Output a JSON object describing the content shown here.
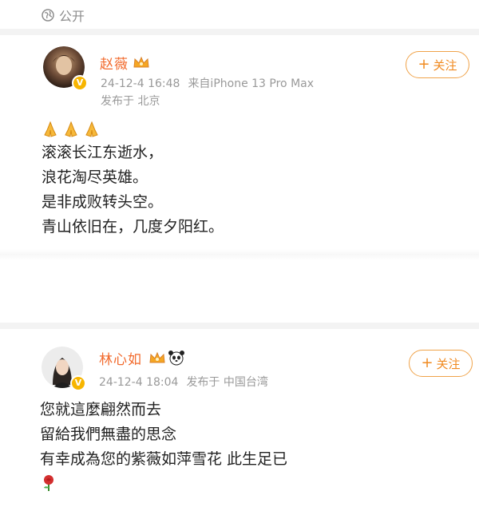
{
  "visibility": {
    "label": "公开",
    "icon": "globe-icon"
  },
  "posts": [
    {
      "author": "赵薇",
      "badge": "crown-icon",
      "verified": "V",
      "time": "24-12-4 16:48",
      "source": "来自iPhone 13 Pro Max",
      "location": "发布于 北京",
      "follow": {
        "plus": "+",
        "label": "关注"
      },
      "emojis": [
        "folded-hands-icon",
        "folded-hands-icon",
        "folded-hands-icon"
      ],
      "lines": [
        "滚滚长江东逝水，",
        "浪花淘尽英雄。",
        "是非成败转头空。",
        "青山依旧在，几度夕阳红。"
      ]
    },
    {
      "author": "林心如",
      "badge": "crown-icon",
      "badge2": "panda-icon",
      "verified": "V",
      "time": "24-12-4 18:04",
      "location": "发布于 中国台湾",
      "follow": {
        "plus": "+",
        "label": "关注"
      },
      "lines": [
        "您就這麼翩然而去",
        "留給我們無盡的思念",
        "有幸成為您的紫薇如萍雪花  此生足已"
      ],
      "trailing_emoji": "rose-icon"
    }
  ],
  "colors": {
    "accent": "#f26b2e",
    "button": "#f08a20",
    "meta": "#999999"
  }
}
